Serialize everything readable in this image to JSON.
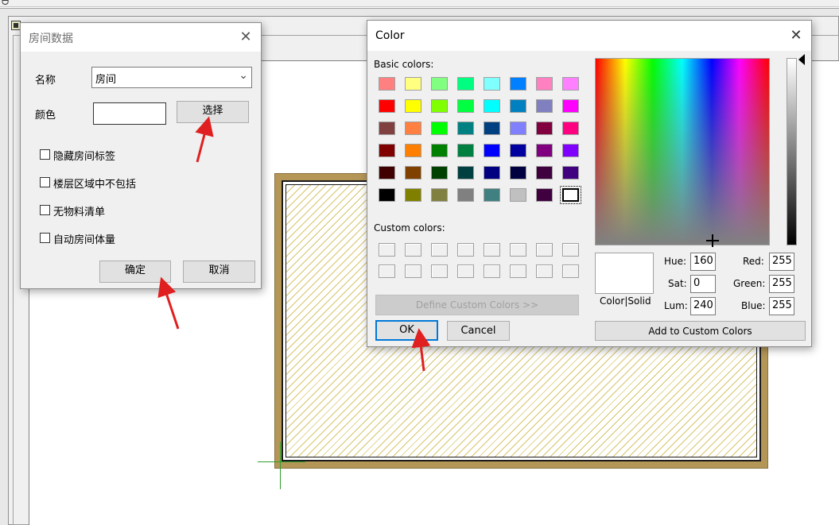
{
  "app": {
    "topbar_glyph": "ᗨ"
  },
  "room_dialog": {
    "title": "房间数据",
    "name_label": "名称",
    "name_value": "房间",
    "color_label": "颜色",
    "select_button": "选择",
    "checkboxes": [
      {
        "label": "隐藏房间标签",
        "checked": false
      },
      {
        "label": "楼层区域中不包括",
        "checked": false
      },
      {
        "label": "无物料清单",
        "checked": false
      },
      {
        "label": "自动房间体量",
        "checked": false
      }
    ],
    "ok_button": "确定",
    "cancel_button": "取消",
    "color_swatch": "#ffffff"
  },
  "color_dialog": {
    "title": "Color",
    "basic_colors_label": "Basic colors:",
    "custom_colors_label": "Custom colors:",
    "basic_colors": [
      "#ff8080",
      "#ffff80",
      "#80ff80",
      "#00ff80",
      "#80ffff",
      "#0080ff",
      "#ff80c0",
      "#ff80ff",
      "#ff0000",
      "#ffff00",
      "#80ff00",
      "#00ff40",
      "#00ffff",
      "#0080c0",
      "#8080c0",
      "#ff00ff",
      "#804040",
      "#ff8040",
      "#00ff00",
      "#008080",
      "#004080",
      "#8080ff",
      "#800040",
      "#ff0080",
      "#800000",
      "#ff8000",
      "#008000",
      "#008040",
      "#0000ff",
      "#0000a0",
      "#800080",
      "#8000ff",
      "#400000",
      "#804000",
      "#004000",
      "#004040",
      "#000080",
      "#000040",
      "#400040",
      "#400080",
      "#000000",
      "#808000",
      "#808040",
      "#808080",
      "#408080",
      "#c0c0c0",
      "#400040",
      "#ffffff"
    ],
    "selected_index": 47,
    "custom_color_count": 16,
    "define_button": "Define Custom Colors >>",
    "ok_button": "OK",
    "cancel_button": "Cancel",
    "color_solid_label": "Color|Solid",
    "hue_label": "Hue:",
    "hue_value": "160",
    "sat_label": "Sat:",
    "sat_value": "0",
    "lum_label": "Lum:",
    "lum_value": "240",
    "red_label": "Red:",
    "red_value": "255",
    "green_label": "Green:",
    "green_value": "255",
    "blue_label": "Blue:",
    "blue_value": "255",
    "add_custom_button": "Add to Custom Colors",
    "preview_color": "#ffffff"
  },
  "annotation_color": "#e02020"
}
